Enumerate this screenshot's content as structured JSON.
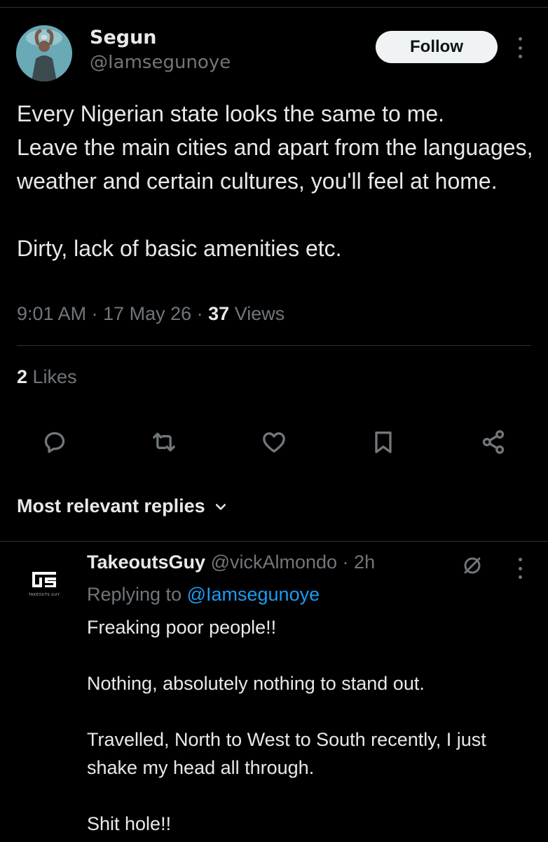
{
  "tweet": {
    "author": {
      "name": "Segun",
      "handle": "@Iamsegunoye"
    },
    "follow_label": "Follow",
    "text": "Every Nigerian state looks the same to me.\nLeave the main cities and apart from the languages, weather and certain cultures, you'll feel at home.\n\nDirty, lack of basic amenities etc.",
    "time": "9:01 AM",
    "separator": " · ",
    "date": "17 May 26",
    "views_count": "37",
    "views_label": " Views",
    "likes_count": "2",
    "likes_label": " Likes"
  },
  "actions": {
    "icons": [
      "reply-icon",
      "retweet-icon",
      "like-icon",
      "bookmark-icon",
      "share-icon"
    ]
  },
  "replies_header": {
    "label": "Most relevant replies"
  },
  "reply": {
    "name": "TakeoutsGuy",
    "handle": "@vickAlmondo",
    "separator": " · ",
    "time": "2h",
    "replying_prefix": "Replying to ",
    "replying_to": "@Iamsegunoye",
    "text": "Freaking poor people!!\n\nNothing, absolutely nothing to stand out.\n\nTravelled, North to West to South recently, I just shake my head all through.\n\nShit hole!!",
    "avatar_caption": "TAKEOUTS GUY"
  },
  "colors": {
    "background": "#000000",
    "text_primary": "#e7e9ea",
    "text_secondary": "#71767b",
    "link": "#1d9bf0",
    "divider": "#2f3336",
    "follow_bg": "#eff3f4"
  }
}
